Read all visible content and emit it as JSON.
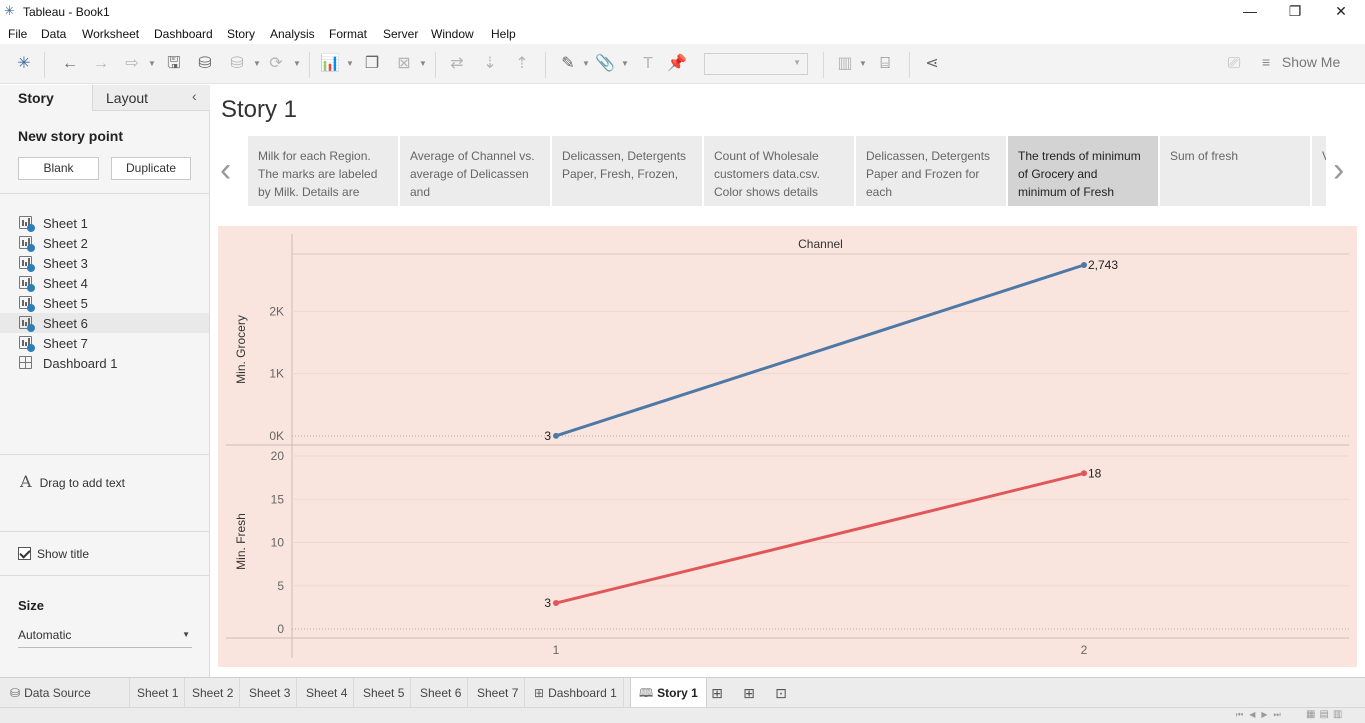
{
  "window": {
    "title": "Tableau - Book1"
  },
  "menu": [
    "File",
    "Data",
    "Worksheet",
    "Dashboard",
    "Story",
    "Analysis",
    "Format",
    "Server",
    "Window",
    "Help"
  ],
  "toolbar": {
    "show_me": "Show Me"
  },
  "panel": {
    "tabs": {
      "story": "Story",
      "layout": "Layout"
    },
    "new_story_point": "New story point",
    "blank": "Blank",
    "duplicate": "Duplicate",
    "sheets": [
      "Sheet 1",
      "Sheet 2",
      "Sheet 3",
      "Sheet 4",
      "Sheet 5",
      "Sheet 6",
      "Sheet 7",
      "Dashboard 1"
    ],
    "drag_text": "Drag to add text",
    "show_title": "Show title",
    "size_label": "Size",
    "size_value": "Automatic"
  },
  "story": {
    "title": "Story 1",
    "points": [
      {
        "text": "Milk for each Region.  The marks are labeled by Milk.  Details are",
        "active": false
      },
      {
        "text": "Average of Channel vs. average of Delicassen and",
        "active": false
      },
      {
        "text": "Delicassen, Detergents Paper, Fresh, Frozen,",
        "active": false
      },
      {
        "text": "Count of Wholesale customers data.csv.  Color shows details",
        "active": false
      },
      {
        "text": "Delicassen, Detergents Paper and Frozen for each",
        "active": false
      },
      {
        "text": "The trends of minimum of Grocery and minimum of Fresh",
        "active": true
      },
      {
        "text": "Sum of fresh",
        "active": false
      },
      {
        "text": "Va",
        "active": false
      }
    ]
  },
  "chart_data": {
    "type": "line",
    "column_header": "Channel",
    "categories": [
      "1",
      "2"
    ],
    "x_tick_labels": [
      "1",
      "2"
    ],
    "panes": [
      {
        "ylabel": "Min. Grocery",
        "color": "#4e79a7",
        "values": [
          3,
          2743
        ],
        "data_labels": [
          "3",
          "2,743"
        ],
        "ylim": [
          0,
          2743
        ],
        "ticks": [
          0,
          1000,
          2000
        ],
        "tick_labels": [
          "0K",
          "1K",
          "2K"
        ]
      },
      {
        "ylabel": "Min. Fresh",
        "color": "#e15759",
        "values": [
          3,
          18
        ],
        "data_labels": [
          "3",
          "18"
        ],
        "ylim": [
          0,
          20
        ],
        "ticks": [
          0,
          5,
          10,
          15,
          20
        ],
        "tick_labels": [
          "0",
          "5",
          "10",
          "15",
          "20"
        ]
      }
    ],
    "background": "#f9e5dd"
  },
  "bottom_tabs": {
    "data_source": "Data Source",
    "sheets": [
      "Sheet 1",
      "Sheet 2",
      "Sheet 3",
      "Sheet 4",
      "Sheet 5",
      "Sheet 6",
      "Sheet 7"
    ],
    "dashboard": "Dashboard 1",
    "story": "Story 1"
  }
}
